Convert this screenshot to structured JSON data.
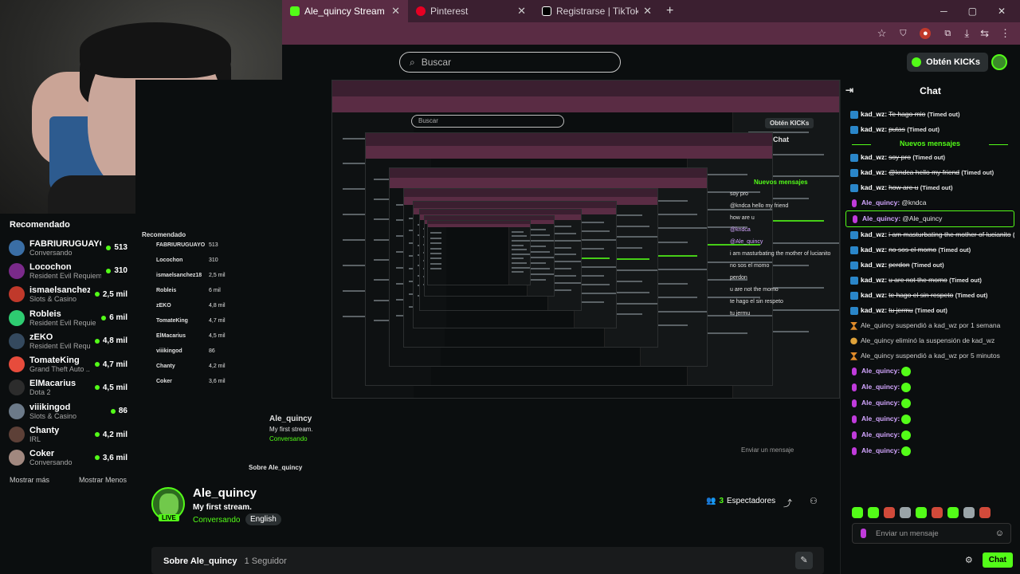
{
  "browser": {
    "tabs": [
      {
        "title": "Ale_quincy Stream - Watch Live",
        "icon_color": "#53fc18",
        "active": true
      },
      {
        "title": "Pinterest",
        "icon_color": "#e60023",
        "active": false
      },
      {
        "title": "Registrarse | TikTok",
        "icon_color": "#ffffff",
        "active": false
      }
    ],
    "new_tab": "+",
    "window_controls": [
      "─",
      "▢",
      "✕"
    ]
  },
  "header": {
    "search_placeholder": "Buscar",
    "kicks_button": "Obtén KICKs"
  },
  "sidebar": {
    "title": "Recomendado",
    "items": [
      {
        "name": "FABRIURUGUAYO",
        "category": "Conversando",
        "viewers": "513",
        "avatar_color": "#3a6ea5"
      },
      {
        "name": "Locochon",
        "category": "Resident Evil Requiem",
        "viewers": "310",
        "avatar_color": "#7a2a8a"
      },
      {
        "name": "ismaelsanchez18",
        "category": "Slots & Casino",
        "viewers": "2,5 mil",
        "avatar_color": "#c0392b"
      },
      {
        "name": "Robleis",
        "category": "Resident Evil Requiem",
        "viewers": "6 mil",
        "avatar_color": "#2ecc71"
      },
      {
        "name": "zEKO",
        "category": "Resident Evil Requ...",
        "viewers": "4,8 mil",
        "avatar_color": "#34495e"
      },
      {
        "name": "TomateKing",
        "category": "Grand Theft Auto ...",
        "viewers": "4,7 mil",
        "avatar_color": "#e74c3c"
      },
      {
        "name": "ElMacarius",
        "category": "Dota 2",
        "viewers": "4,5 mil",
        "avatar_color": "#2c2c2c"
      },
      {
        "name": "viiikingod",
        "category": "Slots & Casino",
        "viewers": "86",
        "avatar_color": "#6c7a89"
      },
      {
        "name": "Chanty",
        "category": "IRL",
        "viewers": "4,2 mil",
        "avatar_color": "#5d4037"
      },
      {
        "name": "Coker",
        "category": "Conversando",
        "viewers": "3,6 mil",
        "avatar_color": "#a1887f"
      }
    ],
    "show_more": "Mostrar más",
    "show_less": "Mostrar Menos"
  },
  "stream": {
    "streamer": "Ale_quincy",
    "title": "My first stream.",
    "category": "Conversando",
    "language": "English",
    "live_badge": "LIVE",
    "viewers_count": "3",
    "viewers_label": "Espectadores",
    "about_title": "Sobre Ale_quincy",
    "followers": "1 Seguidor"
  },
  "chat": {
    "title": "Chat",
    "new_messages": "Nuevos mensajes",
    "timed_out": "(Timed out)",
    "messages": [
      {
        "user": "kad_wz",
        "text": "Te hago mio",
        "deleted": true,
        "kind": "kad"
      },
      {
        "user": "kad_wz",
        "text": "putas",
        "deleted": true,
        "kind": "kad"
      },
      {
        "separator": true
      },
      {
        "user": "kad_wz",
        "text": "soy pro",
        "deleted": true,
        "kind": "kad"
      },
      {
        "user": "kad_wz",
        "text": "@kndca hello my friend",
        "deleted": true,
        "kind": "kad"
      },
      {
        "user": "kad_wz",
        "text": "how are u",
        "deleted": true,
        "kind": "kad"
      },
      {
        "user": "Ale_quincy",
        "text": "@kndca",
        "deleted": false,
        "kind": "ale"
      },
      {
        "user": "Ale_quincy",
        "text": "@Ale_quincy",
        "deleted": false,
        "kind": "ale",
        "highlight": true
      },
      {
        "user": "kad_wz",
        "text": "i am masturbating the mother of lucianito",
        "deleted": true,
        "kind": "kad"
      },
      {
        "user": "kad_wz",
        "text": "no sos el momo",
        "deleted": true,
        "kind": "kad"
      },
      {
        "user": "kad_wz",
        "text": "perdon",
        "deleted": true,
        "kind": "kad"
      },
      {
        "user": "kad_wz",
        "text": "u are not the momo",
        "deleted": true,
        "kind": "kad"
      },
      {
        "user": "kad_wz",
        "text": "te hago el sin respeto",
        "deleted": true,
        "kind": "kad"
      },
      {
        "user": "kad_wz",
        "text": "tu jermu",
        "deleted": true,
        "kind": "kad"
      },
      {
        "system": "Ale_quincy suspendió a kad_wz por 1 semana",
        "icon": "hourglass"
      },
      {
        "system": "Ale_quincy eliminó la suspensión de kad_wz",
        "icon": "undo"
      },
      {
        "system": "Ale_quincy suspendió a kad_wz por 5 minutos",
        "icon": "hourglass"
      },
      {
        "user": "Ale_quincy",
        "text": "",
        "emote": true,
        "kind": "ale"
      },
      {
        "user": "Ale_quincy",
        "text": "",
        "emote": true,
        "kind": "ale"
      },
      {
        "user": "Ale_quincy",
        "text": "",
        "emote": true,
        "kind": "ale"
      },
      {
        "user": "Ale_quincy",
        "text": "",
        "emote": true,
        "kind": "ale"
      },
      {
        "user": "Ale_quincy",
        "text": "",
        "emote": true,
        "kind": "ale"
      },
      {
        "user": "Ale_quincy",
        "text": "",
        "emote": true,
        "kind": "ale"
      }
    ],
    "input_placeholder": "Enviar un mensaje",
    "send_button": "Chat"
  },
  "colors": {
    "accent": "#53fc18",
    "username_kad": "#ffffff",
    "username_ale": "#d3a6ff"
  }
}
